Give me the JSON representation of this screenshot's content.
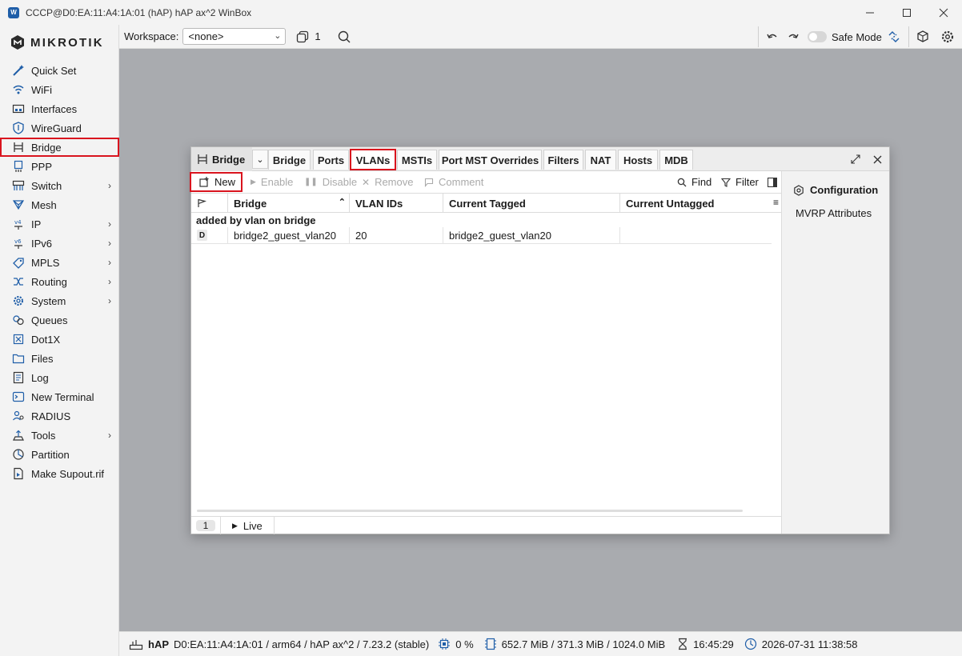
{
  "window": {
    "title": "CCCP@D0:EA:11:A4:1A:01 (hAP) hAP ax^2 WinBox",
    "app_icon": "W",
    "controls": [
      "minimize-icon",
      "maximize-icon",
      "close-icon"
    ]
  },
  "brand": {
    "name": "MIKROTIK"
  },
  "sidebar": {
    "items": [
      {
        "label": "Quick Set",
        "icon": "wand-icon",
        "submenu": false
      },
      {
        "label": "WiFi",
        "icon": "wifi-icon",
        "submenu": false
      },
      {
        "label": "Interfaces",
        "icon": "interfaces-icon",
        "submenu": false
      },
      {
        "label": "WireGuard",
        "icon": "wireguard-icon",
        "submenu": false
      },
      {
        "label": "Bridge",
        "icon": "bridge-icon",
        "submenu": false,
        "highlighted": true
      },
      {
        "label": "PPP",
        "icon": "ppp-icon",
        "submenu": false
      },
      {
        "label": "Switch",
        "icon": "switch-icon",
        "submenu": true
      },
      {
        "label": "Mesh",
        "icon": "mesh-icon",
        "submenu": false
      },
      {
        "label": "IP",
        "icon": "ip-icon",
        "submenu": true
      },
      {
        "label": "IPv6",
        "icon": "ipv6-icon",
        "submenu": true
      },
      {
        "label": "MPLS",
        "icon": "mpls-icon",
        "submenu": true
      },
      {
        "label": "Routing",
        "icon": "routing-icon",
        "submenu": true
      },
      {
        "label": "System",
        "icon": "gear-icon",
        "submenu": true
      },
      {
        "label": "Queues",
        "icon": "queues-icon",
        "submenu": false
      },
      {
        "label": "Dot1X",
        "icon": "dot1x-icon",
        "submenu": false
      },
      {
        "label": "Files",
        "icon": "folder-icon",
        "submenu": false
      },
      {
        "label": "Log",
        "icon": "log-icon",
        "submenu": false
      },
      {
        "label": "New Terminal",
        "icon": "terminal-icon",
        "submenu": false
      },
      {
        "label": "RADIUS",
        "icon": "radius-icon",
        "submenu": false
      },
      {
        "label": "Tools",
        "icon": "tools-icon",
        "submenu": true
      },
      {
        "label": "Partition",
        "icon": "partition-icon",
        "submenu": false
      },
      {
        "label": "Make Supout.rif",
        "icon": "supout-icon",
        "submenu": false
      }
    ]
  },
  "toolbar": {
    "workspace_label": "Workspace:",
    "workspace_value": "<none>",
    "windows_count": "1",
    "safe_mode_label": "Safe Mode"
  },
  "bridge_window": {
    "title": "Bridge",
    "tabs": [
      "Bridge",
      "Ports",
      "VLANs",
      "MSTIs",
      "Port MST Overrides",
      "Filters",
      "NAT",
      "Hosts",
      "MDB"
    ],
    "active_tab": "VLANs",
    "actions": {
      "new": "New",
      "enable": "Enable",
      "disable": "Disable",
      "remove": "Remove",
      "comment": "Comment",
      "find": "Find",
      "filter": "Filter"
    },
    "columns": [
      "Bridge",
      "VLAN IDs",
      "Current Tagged",
      "Current Untagged"
    ],
    "group_label": "added by vlan on bridge",
    "rows": [
      {
        "flag": "D",
        "bridge": "bridge2_guest_vlan20",
        "vlan_ids": "20",
        "current_tagged": "bridge2_guest_vlan20",
        "current_untagged": ""
      }
    ],
    "row_count": "1",
    "live_label": "Live",
    "side_panel": {
      "heading": "Configuration",
      "items": [
        "MVRP Attributes"
      ]
    }
  },
  "statusbar": {
    "device": "hAP",
    "info": "D0:EA:11:A4:1A:01 / arm64 / hAP ax^2 / 7.23.2 (stable)",
    "cpu": "0 %",
    "memory": "652.7 MiB / 371.3 MiB / 1024.0 MiB",
    "uptime": "16:45:29",
    "datetime": "2026-07-31 11:38:58"
  }
}
